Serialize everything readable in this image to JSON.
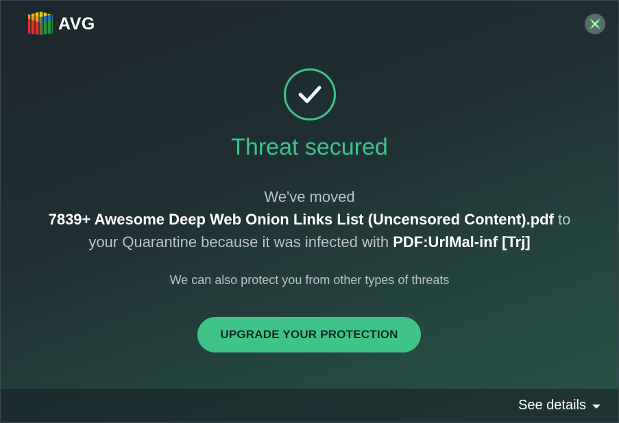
{
  "app": {
    "brand": "AVG"
  },
  "notification": {
    "title": "Threat secured",
    "line1": "We've moved",
    "file_name": "7839+ Awesome Deep Web Onion Links List (Uncensored Content).pdf",
    "to_text": " to",
    "line3_prefix": "your Quarantine because it was infected with ",
    "threat_name": "PDF:UrlMal-inf [Trj]",
    "subtext": "We can also protect you from other types of threats",
    "upgrade_label": "UPGRADE YOUR PROTECTION"
  },
  "footer": {
    "see_details_label": "See details"
  },
  "colors": {
    "accent": "#3ec488",
    "background_dark": "#1d272d",
    "background_green": "#2a5447",
    "text_muted": "#b9c3c8",
    "close_button_bg": "#5b6a70"
  },
  "icons": {
    "logo": "avg-logo-icon",
    "close": "close-icon",
    "status": "checkmark-icon",
    "dropdown": "chevron-down-icon"
  }
}
